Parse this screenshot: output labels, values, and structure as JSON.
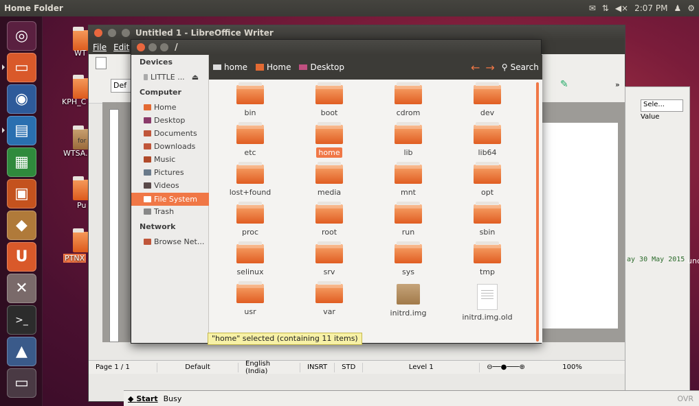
{
  "topbar": {
    "title": "Home Folder",
    "clock": "2:07 PM"
  },
  "desktop": {
    "icons": [
      "WT",
      "KPH_C",
      "WTSA.",
      "Pu",
      "PTNX"
    ],
    "small_label": "for"
  },
  "writer": {
    "title": "Untitled 1 - LibreOffice Writer",
    "menu": [
      "File",
      "Edit"
    ],
    "style_box": "Def",
    "status": {
      "page": "Page 1 / 1",
      "style": "Default",
      "lang": "English (India)",
      "mode1": "INSRT",
      "mode2": "STD",
      "level": "Level 1",
      "zoom": "100%"
    },
    "side_select": "Sele...",
    "side_value": "Value",
    "date_text": "ay 30 May 2015",
    "unc": "unc"
  },
  "fm": {
    "title": "/",
    "devices_header": "Devices",
    "device_item": "LITTLE ...",
    "computer_header": "Computer",
    "places": [
      "Home",
      "Desktop",
      "Documents",
      "Downloads",
      "Music",
      "Pictures",
      "Videos",
      "File System",
      "Trash"
    ],
    "network_header": "Network",
    "network_item": "Browse Net...",
    "crumbs": [
      "home",
      "Home",
      "Desktop"
    ],
    "search": "Search",
    "items": [
      "bin",
      "boot",
      "cdrom",
      "dev",
      "etc",
      "home",
      "lib",
      "lib64",
      "lost+found",
      "media",
      "mnt",
      "opt",
      "proc",
      "root",
      "run",
      "sbin",
      "selinux",
      "srv",
      "sys",
      "tmp",
      "usr",
      "var",
      "initrd.img",
      "initrd.img.old"
    ],
    "status": "\"home\" selected (containing 11 items)"
  },
  "taskbar": {
    "start": "Start",
    "busy": "Busy",
    "ovr": "OVR"
  }
}
